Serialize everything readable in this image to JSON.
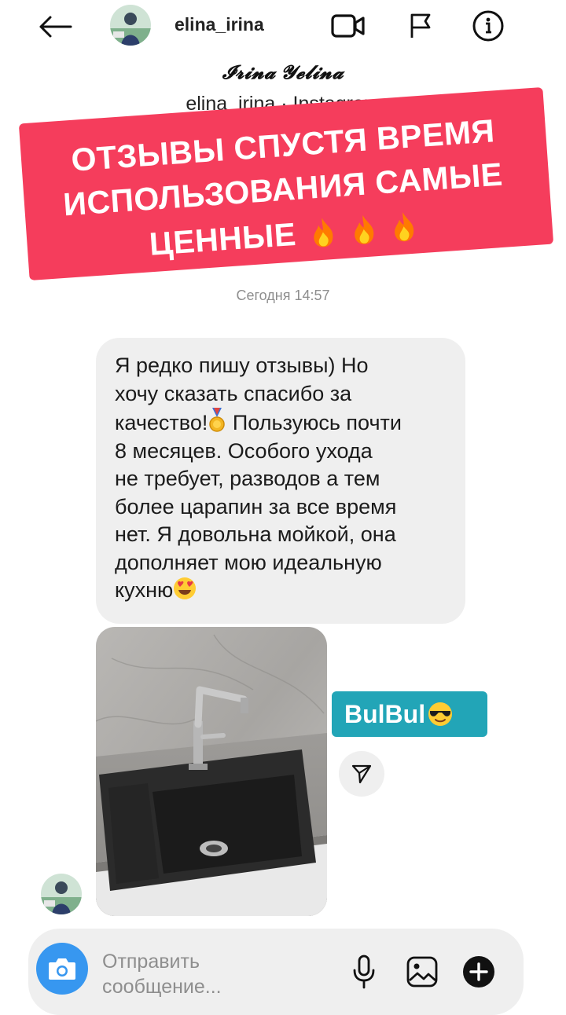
{
  "header": {
    "username": "elina_irina",
    "icons": [
      "back-arrow-icon",
      "video-call-icon",
      "flag-icon",
      "info-icon"
    ]
  },
  "profile": {
    "full_name": "𝓘𝓻𝓲𝓷𝓪 𝓨𝓮𝓵𝓲𝓷𝓪",
    "subtitle": "elina_irina · Instagram"
  },
  "banner": {
    "line1": "ОТЗЫВЫ СПУСТЯ ВРЕМЯ",
    "line2": "ИСПОЛЬЗОВАНИЯ САМЫЕ",
    "line3": "ЦЕННЫЕ",
    "color": "#f53d5c"
  },
  "chat": {
    "timestamp": "Сегодня 14:57",
    "message_lines": [
      "Я редко пишу отзывы) Но",
      "хочу сказать спасибо за",
      "качество!",
      "Пользуюсь почти",
      "8 месяцев. Особого ухода",
      "не требует, разводов а тем",
      "более царапин за все время",
      "нет. Я довольна мойкой, она",
      "дополняет мою идеальную",
      "кухню"
    ],
    "sticker_text": "BulBul",
    "sticker_color": "#22a5b7"
  },
  "composer": {
    "placeholder": "Отправить сообщение...",
    "placeholder_line1": "Отправить",
    "placeholder_line2": "сообщение...",
    "accent": "#3797f0"
  }
}
